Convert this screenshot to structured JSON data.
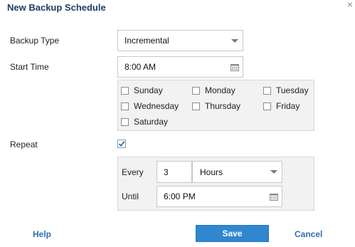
{
  "dialog": {
    "title": "New Backup Schedule",
    "close_glyph": "×"
  },
  "backup_type": {
    "label": "Backup Type",
    "value": "Incremental"
  },
  "start_time": {
    "label": "Start Time",
    "value": "8:00 AM"
  },
  "days": [
    {
      "label": "Sunday",
      "checked": false
    },
    {
      "label": "Monday",
      "checked": false
    },
    {
      "label": "Tuesday",
      "checked": false
    },
    {
      "label": "Wednesday",
      "checked": false
    },
    {
      "label": "Thursday",
      "checked": false
    },
    {
      "label": "Friday",
      "checked": false
    },
    {
      "label": "Saturday",
      "checked": false
    }
  ],
  "repeat": {
    "label": "Repeat",
    "checked": true,
    "every_label": "Every",
    "every_value": "3",
    "unit_value": "Hours",
    "until_label": "Until",
    "until_value": "6:00 PM"
  },
  "footer": {
    "help_label": "Help",
    "save_label": "Save",
    "cancel_label": "Cancel"
  },
  "colors": {
    "title": "#1f3d66",
    "accent": "#2f87d0",
    "link": "#2f6fb0",
    "panel_bg": "#f2f2f2"
  }
}
